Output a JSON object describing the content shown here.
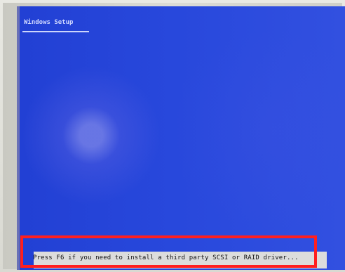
{
  "window": {
    "title": "Windows Setup"
  },
  "status_bar": {
    "message": "Press F6 if you need to install a third party SCSI or RAID driver..."
  },
  "colors": {
    "screen_blue": "#2848dc",
    "status_bar_gray": "#dcdcdc",
    "highlight_red": "#ff1f1f"
  }
}
